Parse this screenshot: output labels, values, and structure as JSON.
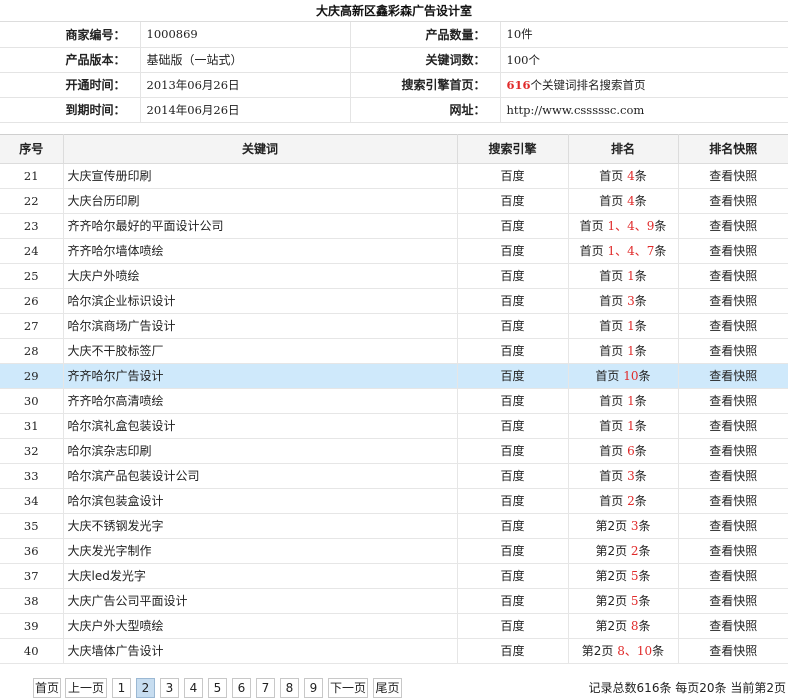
{
  "title": "大庆高新区鑫彩森广告设计室",
  "info": {
    "merchant_label": "商家编号：",
    "merchant_value": "1000869",
    "product_count_label": "产品数量：",
    "product_count_value": "10件",
    "version_label": "产品版本：",
    "version_value": "基础版（一站式）",
    "keyword_count_label": "关键词数：",
    "keyword_count_value": "100个",
    "open_label": "开通时间：",
    "open_value": "2013年06月26日",
    "homepage_label": "搜索引擎首页：",
    "homepage_num": "616",
    "homepage_suffix": "个关键词排名搜索首页",
    "expire_label": "到期时间：",
    "expire_value": "2014年06月26日",
    "url_label": "网址：",
    "url_value": "http://www.csssssc.com"
  },
  "table": {
    "headers": [
      "序号",
      "关键词",
      "搜索引擎",
      "排名",
      "排名快照"
    ],
    "rows": [
      {
        "num": "21",
        "kw": "大庆宣传册印刷",
        "engine": "百度",
        "page": "首页",
        "rank": "4",
        "unit": "条",
        "snap": "查看快照"
      },
      {
        "num": "22",
        "kw": "大庆台历印刷",
        "engine": "百度",
        "page": "首页",
        "rank": "4",
        "unit": "条",
        "snap": "查看快照"
      },
      {
        "num": "23",
        "kw": "齐齐哈尔最好的平面设计公司",
        "engine": "百度",
        "page": "首页",
        "rank": "1、4、9",
        "unit": "条",
        "snap": "查看快照"
      },
      {
        "num": "24",
        "kw": "齐齐哈尔墙体喷绘",
        "engine": "百度",
        "page": "首页",
        "rank": "1、4、7",
        "unit": "条",
        "snap": "查看快照"
      },
      {
        "num": "25",
        "kw": "大庆户外喷绘",
        "engine": "百度",
        "page": "首页",
        "rank": "1",
        "unit": "条",
        "snap": "查看快照"
      },
      {
        "num": "26",
        "kw": "哈尔滨企业标识设计",
        "engine": "百度",
        "page": "首页",
        "rank": "3",
        "unit": "条",
        "snap": "查看快照"
      },
      {
        "num": "27",
        "kw": "哈尔滨商场广告设计",
        "engine": "百度",
        "page": "首页",
        "rank": "1",
        "unit": "条",
        "snap": "查看快照"
      },
      {
        "num": "28",
        "kw": "大庆不干胶标签厂",
        "engine": "百度",
        "page": "首页",
        "rank": "1",
        "unit": "条",
        "snap": "查看快照"
      },
      {
        "num": "29",
        "kw": "齐齐哈尔广告设计",
        "engine": "百度",
        "page": "首页",
        "rank": "10",
        "unit": "条",
        "snap": "查看快照"
      },
      {
        "num": "30",
        "kw": "齐齐哈尔高清喷绘",
        "engine": "百度",
        "page": "首页",
        "rank": "1",
        "unit": "条",
        "snap": "查看快照"
      },
      {
        "num": "31",
        "kw": "哈尔滨礼盒包装设计",
        "engine": "百度",
        "page": "首页",
        "rank": "1",
        "unit": "条",
        "snap": "查看快照"
      },
      {
        "num": "32",
        "kw": "哈尔滨杂志印刷",
        "engine": "百度",
        "page": "首页",
        "rank": "6",
        "unit": "条",
        "snap": "查看快照"
      },
      {
        "num": "33",
        "kw": "哈尔滨产品包装设计公司",
        "engine": "百度",
        "page": "首页",
        "rank": "3",
        "unit": "条",
        "snap": "查看快照"
      },
      {
        "num": "34",
        "kw": "哈尔滨包装盒设计",
        "engine": "百度",
        "page": "首页",
        "rank": "2",
        "unit": "条",
        "snap": "查看快照"
      },
      {
        "num": "35",
        "kw": "大庆不锈钢发光字",
        "engine": "百度",
        "page": "第2页",
        "rank": "3",
        "unit": "条",
        "snap": "查看快照"
      },
      {
        "num": "36",
        "kw": "大庆发光字制作",
        "engine": "百度",
        "page": "第2页",
        "rank": "2",
        "unit": "条",
        "snap": "查看快照"
      },
      {
        "num": "37",
        "kw": "大庆led发光字",
        "engine": "百度",
        "page": "第2页",
        "rank": "5",
        "unit": "条",
        "snap": "查看快照"
      },
      {
        "num": "38",
        "kw": "大庆广告公司平面设计",
        "engine": "百度",
        "page": "第2页",
        "rank": "5",
        "unit": "条",
        "snap": "查看快照"
      },
      {
        "num": "39",
        "kw": "大庆户外大型喷绘",
        "engine": "百度",
        "page": "第2页",
        "rank": "8",
        "unit": "条",
        "snap": "查看快照"
      },
      {
        "num": "40",
        "kw": "大庆墙体广告设计",
        "engine": "百度",
        "page": "第2页",
        "rank": "8、10",
        "unit": "条",
        "snap": "查看快照"
      }
    ],
    "highlight_row": "29"
  },
  "pager": {
    "first": "首页",
    "prev": "上一页",
    "pages": [
      "1",
      "2",
      "3",
      "4",
      "5",
      "6",
      "7",
      "8",
      "9"
    ],
    "current": "2",
    "next": "下一页",
    "last": "尾页",
    "summary": "记录总数616条 每页20条 当前第2页"
  },
  "colors": {
    "accent_red": "#e02a2a",
    "highlight_row": "#cfe9fb",
    "header_bg": "#f4f4f4",
    "current_page": "#c7ddf0"
  }
}
